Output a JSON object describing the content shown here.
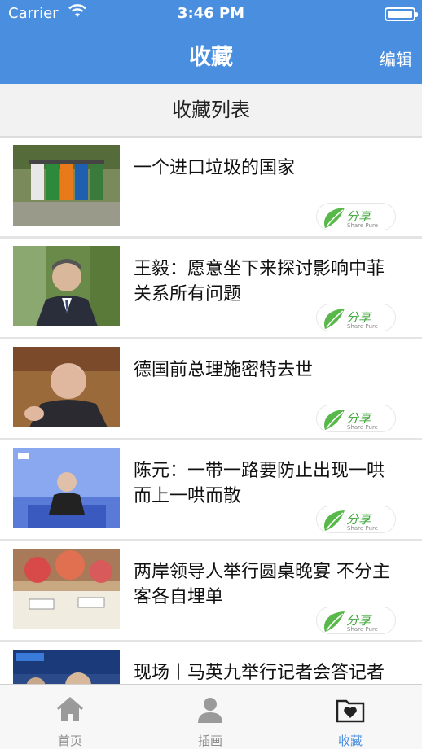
{
  "status": {
    "carrier": "Carrier",
    "time": "3:46 PM"
  },
  "nav": {
    "title": "收藏",
    "edit": "编辑"
  },
  "section": {
    "title": "收藏列表"
  },
  "items": [
    {
      "title": "一个进口垃圾的国家"
    },
    {
      "title": "王毅：愿意坐下来探讨影响中菲关系所有问题"
    },
    {
      "title": "德国前总理施密特去世"
    },
    {
      "title": "陈元：一带一路要防止出现一哄而上一哄而散"
    },
    {
      "title": "两岸领导人举行圆桌晚宴 不分主客各自埋单"
    },
    {
      "title": "现场丨马英九举行记者会答记者问（下）"
    }
  ],
  "share_badge": {
    "text": "分享",
    "sub": "Share Pure"
  },
  "tabs": [
    {
      "label": "首页",
      "icon": "home-icon"
    },
    {
      "label": "插画",
      "icon": "person-icon"
    },
    {
      "label": "收藏",
      "icon": "folder-heart-icon"
    }
  ],
  "colors": {
    "nav_blue": "#4a8ee0",
    "tab_active": "#4a8ee0",
    "tab_inactive": "#8e8e8e"
  }
}
